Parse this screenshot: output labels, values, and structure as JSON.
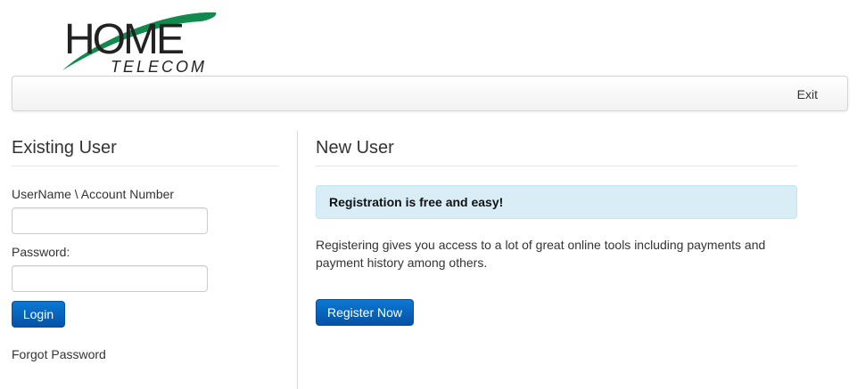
{
  "logo": {
    "line1": "HOME",
    "line2": "TELECOM",
    "brand_dark": "#222222",
    "brand_green": "#128a4d"
  },
  "navbar": {
    "exit_label": "Exit"
  },
  "existing_user": {
    "title": "Existing User",
    "username_label": "UserName \\ Account Number",
    "username_value": "",
    "password_label": "Password:",
    "password_value": "",
    "login_label": "Login",
    "forgot_label": "Forgot Password"
  },
  "new_user": {
    "title": "New User",
    "alert_text": "Registration is free and easy!",
    "description": "Registering gives you access to a lot of great online tools including payments and payment history among others.",
    "register_label": "Register Now"
  },
  "colors": {
    "primary_button": "#0765bd",
    "alert_bg": "#d9edf7",
    "alert_border": "#bce8f1"
  }
}
